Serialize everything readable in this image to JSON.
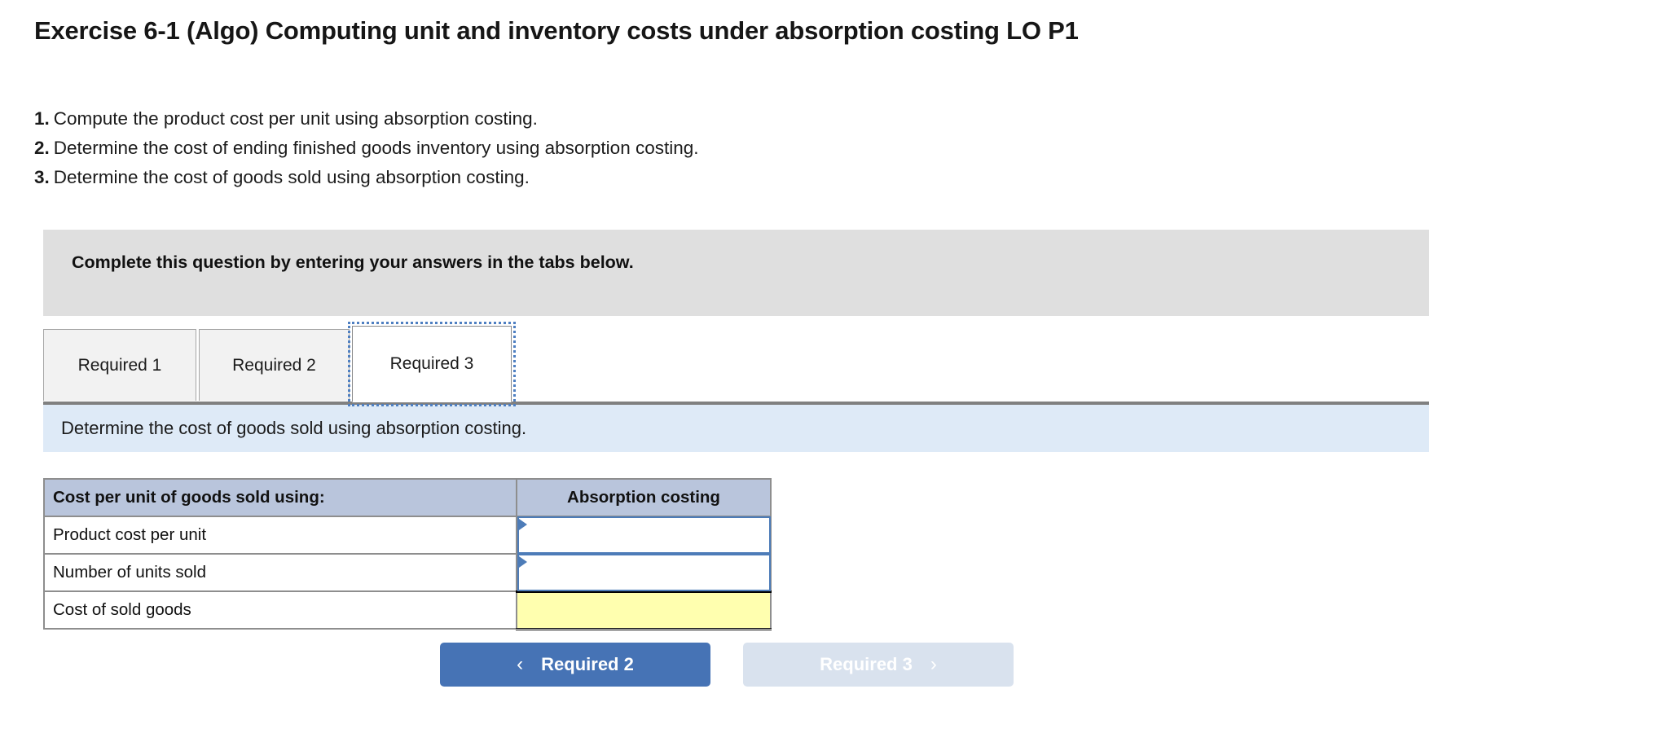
{
  "page_title": "Exercise 6-1 (Algo) Computing unit and inventory costs under absorption costing LO P1",
  "requirements": [
    {
      "num": "1.",
      "text": "Compute the product cost per unit using absorption costing."
    },
    {
      "num": "2.",
      "text": "Determine the cost of ending finished goods inventory using absorption costing."
    },
    {
      "num": "3.",
      "text": "Determine the cost of goods sold using absorption costing."
    }
  ],
  "banner": {
    "text": "Complete this question by entering your answers in the tabs below."
  },
  "tabs": [
    {
      "label": "Required 1",
      "active": false
    },
    {
      "label": "Required 2",
      "active": false
    },
    {
      "label": "Required 3",
      "active": true
    }
  ],
  "instruction": {
    "text": "Determine the cost of goods sold using absorption costing."
  },
  "table": {
    "headers": [
      "Cost per unit of goods sold using:",
      "Absorption costing"
    ],
    "rows": [
      {
        "label": "Product cost per unit",
        "value": "",
        "type": "input"
      },
      {
        "label": "Number of units sold",
        "value": "",
        "type": "input"
      },
      {
        "label": "Cost of sold goods",
        "value": "",
        "type": "total"
      }
    ]
  },
  "nav": {
    "prev_label": "Required 2",
    "prev_icon": "chevron-left-icon",
    "prev_glyph": "‹",
    "next_label": "Required 3",
    "next_icon": "chevron-right-icon",
    "next_glyph": "›"
  },
  "colors": {
    "banner_gray": "#dfdfdf",
    "instruction_blue": "#deeaf7",
    "table_header": "#b9c5dc",
    "input_border": "#4d7cb8",
    "total_yellow": "#ffffaf",
    "nav_active": "#4673b5",
    "nav_disabled": "#d9e2ee"
  }
}
